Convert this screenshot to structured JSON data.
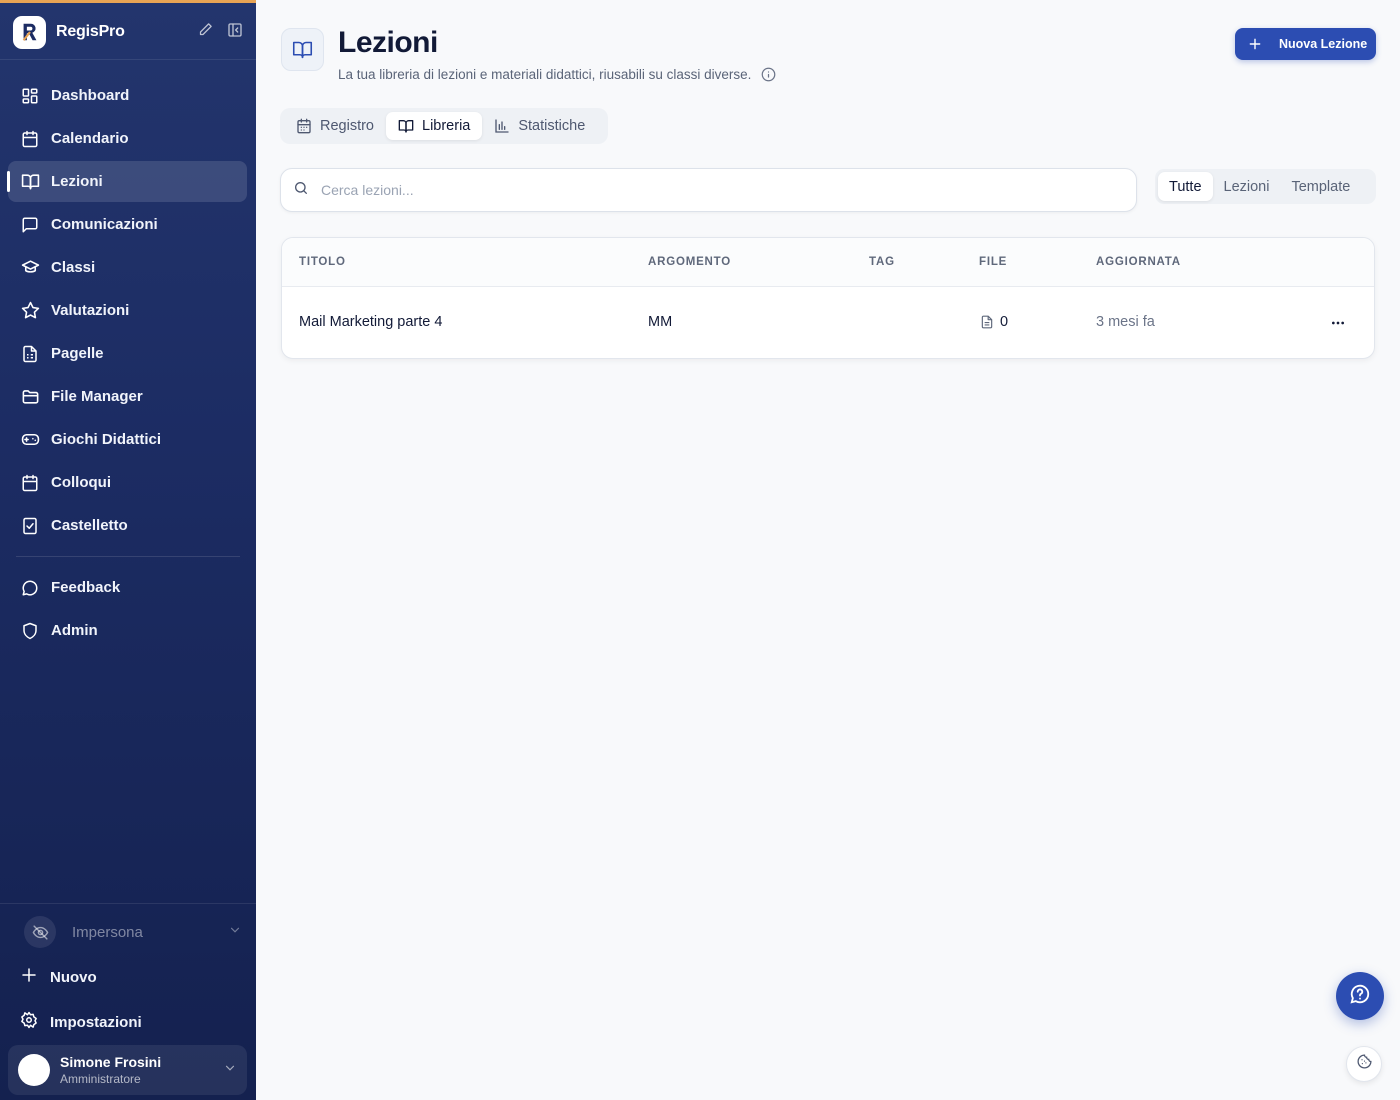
{
  "app": {
    "name": "RegisPro"
  },
  "sidebar": {
    "items": [
      {
        "label": "Dashboard",
        "icon": "dashboard-icon"
      },
      {
        "label": "Calendario",
        "icon": "calendar-icon"
      },
      {
        "label": "Lezioni",
        "icon": "book-icon",
        "active": true
      },
      {
        "label": "Comunicazioni",
        "icon": "chat-icon"
      },
      {
        "label": "Classi",
        "icon": "graduation-cap-icon"
      },
      {
        "label": "Valutazioni",
        "icon": "star-icon"
      },
      {
        "label": "Pagelle",
        "icon": "report-card-icon"
      },
      {
        "label": "File Manager",
        "icon": "folder-icon"
      },
      {
        "label": "Giochi Didattici",
        "icon": "gamepad-icon"
      },
      {
        "label": "Colloqui",
        "icon": "calendar-icon"
      },
      {
        "label": "Castelletto",
        "icon": "checklist-icon"
      }
    ],
    "secondary": [
      {
        "label": "Feedback",
        "icon": "message-circle-icon"
      },
      {
        "label": "Admin",
        "icon": "shield-icon"
      }
    ],
    "impersona": "Impersona",
    "new_label": "Nuovo",
    "settings_label": "Impostazioni",
    "user": {
      "name": "Simone Frosini",
      "role": "Amministratore"
    }
  },
  "header": {
    "title": "Lezioni",
    "subtitle": "La tua libreria di lezioni e materiali didattici, riusabili su classi diverse.",
    "new_button": "Nuova Lezione"
  },
  "view_tabs": [
    {
      "label": "Registro",
      "icon": "calendar-icon"
    },
    {
      "label": "Libreria",
      "icon": "book-icon",
      "active": true
    },
    {
      "label": "Statistiche",
      "icon": "bar-chart-icon"
    }
  ],
  "search": {
    "placeholder": "Cerca lezioni...",
    "value": ""
  },
  "filter_tabs": [
    {
      "label": "Tutte",
      "active": true
    },
    {
      "label": "Lezioni"
    },
    {
      "label": "Template"
    }
  ],
  "table": {
    "columns": [
      "TITOLO",
      "ARGOMENTO",
      "TAG",
      "FILE",
      "AGGIORNATA"
    ],
    "rows": [
      {
        "titolo": "Mail Marketing parte 4",
        "argomento": "MM",
        "tag": "",
        "file": "0",
        "aggiornata": "3 mesi fa"
      }
    ]
  },
  "colors": {
    "accent": "#2c4db2",
    "sidebar": "#1c2c63",
    "highlight": "#e8a454"
  }
}
